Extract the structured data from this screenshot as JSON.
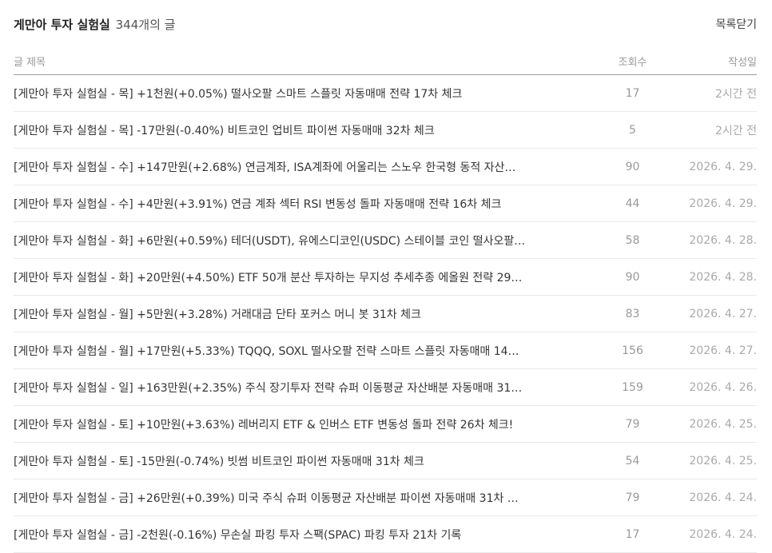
{
  "header": {
    "category": "게만아 투자 실험실",
    "count": "344개의 글",
    "close_label": "목록닫기"
  },
  "columns": {
    "title": "글 제목",
    "views": "조회수",
    "date": "작성일"
  },
  "posts": [
    {
      "title": "[게만아 투자 실험실 - 목] +1천원(+0.05%) 떨사오팔 스마트 스플릿 자동매매 전략 17차 체크",
      "views": "17",
      "date": "2시간 전"
    },
    {
      "title": "[게만아 투자 실험실 - 목] -17만원(-0.40%) 비트코인 업비트 파이썬 자동매매 32차 체크",
      "views": "5",
      "date": "2시간 전"
    },
    {
      "title": "[게만아 투자 실험실 - 수] +147만원(+2.68%) 연금계좌, ISA계좌에 어울리는 스노우 한국형 동적 자산…",
      "views": "90",
      "date": "2026. 4. 29."
    },
    {
      "title": "[게만아 투자 실험실 - 수] +4만원(+3.91%) 연금 계좌 섹터 RSI 변동성 돌파 자동매매 전략 16차 체크",
      "views": "44",
      "date": "2026. 4. 29."
    },
    {
      "title": "[게만아 투자 실험실 - 화] +6만원(+0.59%) 테더(USDT), 유에스디코인(USDC) 스테이블 코인 떨사오팔…",
      "views": "58",
      "date": "2026. 4. 28."
    },
    {
      "title": "[게만아 투자 실험실 - 화] +20만원(+4.50%) ETF 50개 분산 투자하는 무지성 추세추종 에올원 전략 29…",
      "views": "90",
      "date": "2026. 4. 28."
    },
    {
      "title": "[게만아 투자 실험실 - 월] +5만원(+3.28%) 거래대금 단타 포커스 머니 봇 31차 체크",
      "views": "83",
      "date": "2026. 4. 27."
    },
    {
      "title": "[게만아 투자 실험실 - 월] +17만원(+5.33%) TQQQ, SOXL 떨사오팔 전략 스마트 스플릿 자동매매 14…",
      "views": "156",
      "date": "2026. 4. 27."
    },
    {
      "title": "[게만아 투자 실험실 - 일] +163만원(+2.35%) 주식 장기투자 전략 슈퍼 이동평균 자산배분 자동매매 31…",
      "views": "159",
      "date": "2026. 4. 26."
    },
    {
      "title": "[게만아 투자 실험실 - 토] +10만원(+3.63%) 레버리지 ETF & 인버스 ETF 변동성 돌파 전략 26차 체크!",
      "views": "79",
      "date": "2026. 4. 25."
    },
    {
      "title": "[게만아 투자 실험실 - 토] -15만원(-0.74%) 빗썸 비트코인 파이썬 자동매매 31차 체크",
      "views": "54",
      "date": "2026. 4. 25."
    },
    {
      "title": "[게만아 투자 실험실 - 금] +26만원(+0.39%) 미국 주식 슈퍼 이동평균 자산배분 파이썬 자동매매 31차 …",
      "views": "79",
      "date": "2026. 4. 24."
    },
    {
      "title": "[게만아 투자 실험실 - 금] -2천원(-0.16%) 무손실 파킹 투자 스팩(SPAC) 파킹 투자 21차 기록",
      "views": "17",
      "date": "2026. 4. 24."
    }
  ]
}
